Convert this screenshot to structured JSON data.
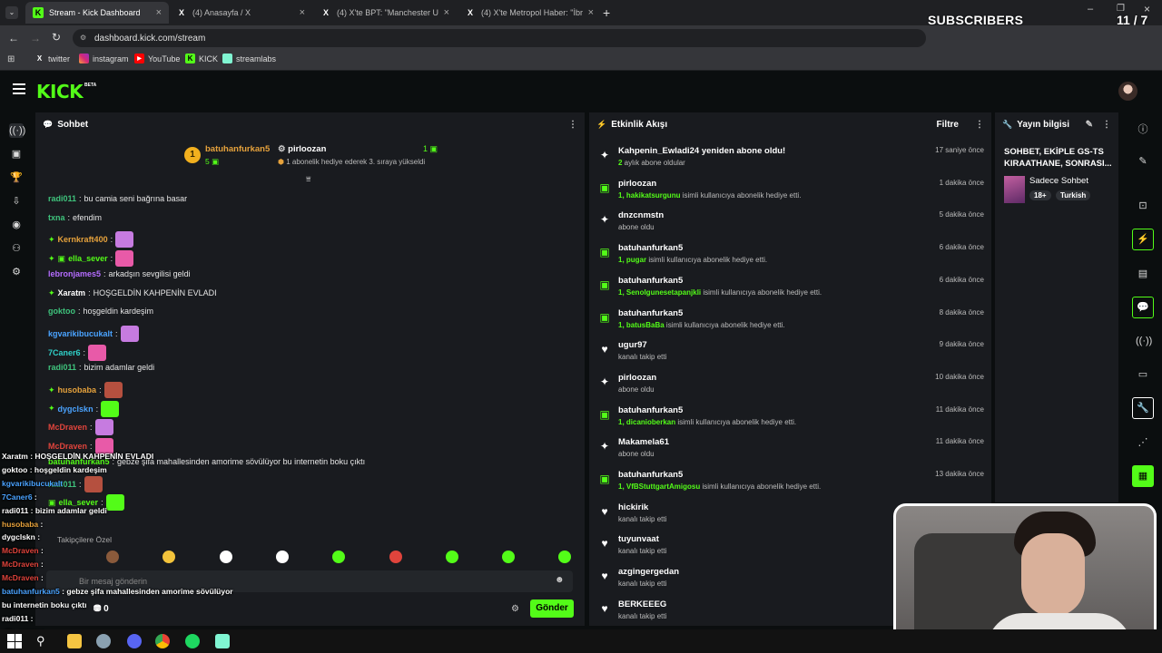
{
  "browser": {
    "tabs": [
      {
        "title": "Stream - Kick Dashboard",
        "icon": "K",
        "active": true
      },
      {
        "title": "(4) Anasayfa / X",
        "icon": "X",
        "active": false
      },
      {
        "title": "(4) X'te BPT: \"Manchester Unit",
        "icon": "X",
        "active": false
      },
      {
        "title": "(4) X'te Metropol Haber: \"İbrah",
        "icon": "X",
        "active": false
      }
    ],
    "url": "dashboard.kick.com/stream",
    "bookmarks": [
      "twitter",
      "instagram",
      "YouTube",
      "KICK",
      "streamlabs"
    ]
  },
  "overlay_subs": {
    "label": "SUBSCRIBERS",
    "count": "11 / 7",
    "progress": 0.95
  },
  "kick": {
    "logo": "KICK",
    "beta": "BETA"
  },
  "chat": {
    "title": "Sohbet",
    "pinned": {
      "rank": "1",
      "user1": "batuhanfurkan5",
      "user1_count": "5",
      "user2": "pirloozan",
      "user2_count": "1",
      "note": "1 abonelik hediye ederek 3. sıraya yükseldi"
    },
    "messages": [
      {
        "user": "radi011",
        "color": "#3fc37c",
        "text": "bu camia seni bağrına basar"
      },
      {
        "user": "txna",
        "color": "#3fc37c",
        "text": "efendim"
      },
      {
        "user": "Kernkraft400",
        "color": "#e6a23c",
        "text": ""
      },
      {
        "user": "ella_sever",
        "color": "#53fc18",
        "text": ""
      },
      {
        "user": "lebronjames5",
        "color": "#b56cff",
        "text": "arkadşın sevgilisi geldi"
      },
      {
        "user": "Xaratm",
        "color": "#ffffff",
        "text": "HOŞGELDİN KAHPENİN EVLADI"
      },
      {
        "user": "goktoo",
        "color": "#3fc37c",
        "text": "hoşgeldin kardeşim"
      },
      {
        "user": "kgvarikibucukalt",
        "color": "#4aa3ff",
        "text": ""
      },
      {
        "user": "7Caner6",
        "color": "#2fd0c8",
        "text": ""
      },
      {
        "user": "radi011",
        "color": "#3fc37c",
        "text": "bizim adamlar geldi"
      },
      {
        "user": "husobaba",
        "color": "#e6a23c",
        "text": ""
      },
      {
        "user": "dygclskn",
        "color": "#4aa3ff",
        "text": ""
      },
      {
        "user": "McDraven",
        "color": "#e0443c",
        "text": ""
      },
      {
        "user": "McDraven",
        "color": "#e0443c",
        "text": ""
      },
      {
        "user": "batuhanfurkan5",
        "color": "#53fc18",
        "text": "gebze şifa mahallesinden amorime sövülüyor bu internetin boku çıktı"
      },
      {
        "user": "radi011",
        "color": "#3fc37c",
        "text": ""
      },
      {
        "user": "ella_sever",
        "color": "#53fc18",
        "text": ""
      }
    ],
    "followers_only": "Takipçilere Özel",
    "input_placeholder": "Bir mesaj gönderin",
    "send_label": "Gönder",
    "points": "0"
  },
  "activity": {
    "title": "Etkinlik Akışı",
    "filter_label": "Filtre",
    "items": [
      {
        "icon": "sparkle",
        "name": "Kahpenin_Ewladi24 yeniden abone oldu!",
        "hl": "2",
        "rest": " aylık abone oldular",
        "time": "17 saniye önce"
      },
      {
        "icon": "gift",
        "name": "pirloozan",
        "hl": "1, hakikatsurgunu",
        "rest": " isimli kullanıcıya abonelik hediye etti.",
        "time": "1 dakika önce"
      },
      {
        "icon": "sparkle",
        "name": "dnzcnmstn",
        "hl": "",
        "rest": "abone oldu",
        "time": "5 dakika önce"
      },
      {
        "icon": "gift",
        "name": "batuhanfurkan5",
        "hl": "1, pugar",
        "rest": " isimli kullanıcıya abonelik hediye etti.",
        "time": "6 dakika önce"
      },
      {
        "icon": "gift",
        "name": "batuhanfurkan5",
        "hl": "1, Senolgunesetapanjkli",
        "rest": " isimli kullanıcıya abonelik hediye etti.",
        "time": "6 dakika önce"
      },
      {
        "icon": "gift",
        "name": "batuhanfurkan5",
        "hl": "1, batusBaBa",
        "rest": " isimli kullanıcıya abonelik hediye etti.",
        "time": "8 dakika önce"
      },
      {
        "icon": "heart",
        "name": "ugur97",
        "hl": "",
        "rest": "kanalı takip etti",
        "time": "9 dakika önce"
      },
      {
        "icon": "sparkle",
        "name": "pirloozan",
        "hl": "",
        "rest": "abone oldu",
        "time": "10 dakika önce"
      },
      {
        "icon": "gift",
        "name": "batuhanfurkan5",
        "hl": "1, dicanioberkan",
        "rest": " isimli kullanıcıya abonelik hediye etti.",
        "time": "11 dakika önce"
      },
      {
        "icon": "sparkle",
        "name": "Makamela61",
        "hl": "",
        "rest": "abone oldu",
        "time": "11 dakika önce"
      },
      {
        "icon": "gift",
        "name": "batuhanfurkan5",
        "hl": "1, VfBStuttgartAmigosu",
        "rest": " isimli kullanıcıya abonelik hediye etti.",
        "time": "13 dakika önce"
      },
      {
        "icon": "heart",
        "name": "hickirik",
        "hl": "",
        "rest": "kanalı takip etti",
        "time": ""
      },
      {
        "icon": "heart",
        "name": "tuyunvaat",
        "hl": "",
        "rest": "kanalı takip etti",
        "time": ""
      },
      {
        "icon": "heart",
        "name": "azgingergedan",
        "hl": "",
        "rest": "kanalı takip etti",
        "time": ""
      },
      {
        "icon": "heart",
        "name": "BERKEEEG",
        "hl": "",
        "rest": "kanalı takip etti",
        "time": ""
      }
    ]
  },
  "stream_info": {
    "title": "Yayın bilgisi",
    "stream_title": "SOHBET, EKİPLE GS-TS KIRAATHANE, SONRASI...",
    "category": "Sadece Sohbet",
    "tags": [
      "18+",
      "Turkish"
    ]
  },
  "overlay_chat": [
    {
      "user": "Xaratm",
      "text": " : HOŞGELDİN KAHPENİN EVLADI"
    },
    {
      "user": "goktoo",
      "text": " : hoşgeldin kardeşim"
    },
    {
      "user": "kgvarikibucukalt",
      "text": ""
    },
    {
      "user": "7Caner6",
      "text": " :"
    },
    {
      "user": "radi011",
      "text": " : bizim adamlar geldi"
    },
    {
      "user": "husobaba",
      "text": " :"
    },
    {
      "user": "dygclskn",
      "text": " :"
    },
    {
      "user": "McDraven",
      "text": " :"
    },
    {
      "user": "McDraven",
      "text": " :"
    },
    {
      "user": "McDraven",
      "text": " :"
    },
    {
      "user": "batuhanfurkan5",
      "text": " : gebze şifa mahallesinden amorime sövülüyor"
    },
    {
      "user": "",
      "text": "bu internetin boku çıktı"
    },
    {
      "user": "radi011",
      "text": " :"
    },
    {
      "user": "ella_sever",
      "text": " :"
    }
  ]
}
